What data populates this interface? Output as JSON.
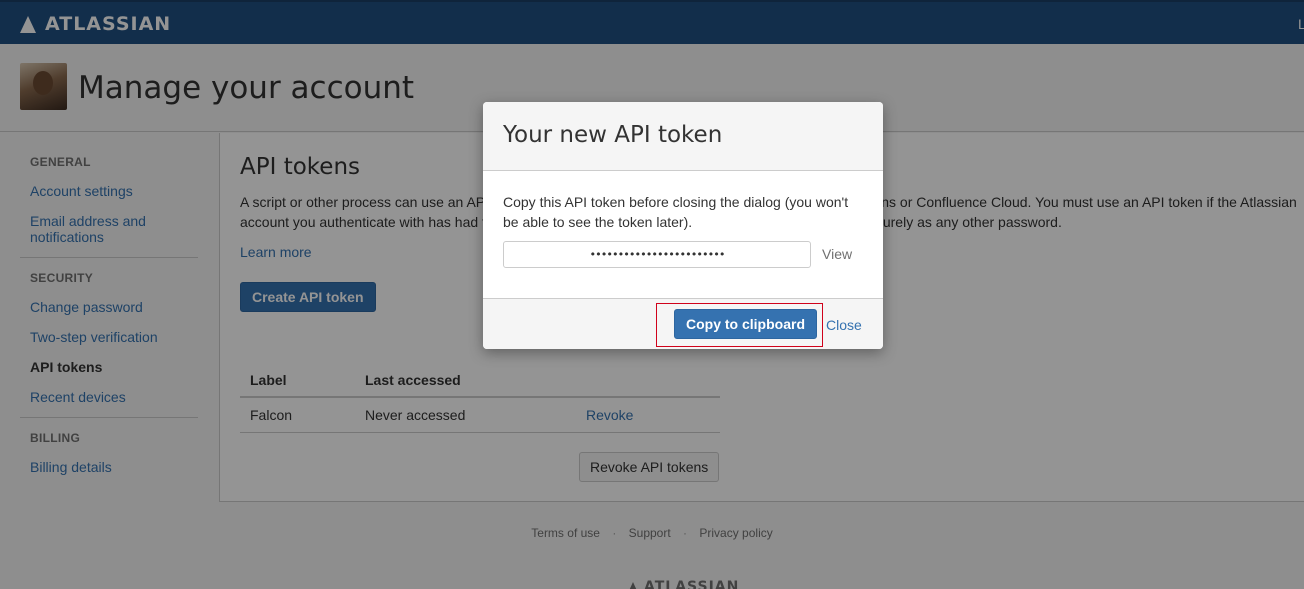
{
  "topbar": {
    "brand": "ATLASSIAN",
    "right_cut": "L"
  },
  "header": {
    "title": "Manage your account"
  },
  "sidebar": {
    "general_heading": "GENERAL",
    "account_settings": "Account settings",
    "email_notifications": "Email address and notifications",
    "security_heading": "SECURITY",
    "change_password": "Change password",
    "two_step": "Two-step verification",
    "api_tokens": "API tokens",
    "recent_devices": "Recent devices",
    "billing_heading": "BILLING",
    "billing_details": "Billing details"
  },
  "main": {
    "title": "API tokens",
    "description": "A script or other process can use an API token to perform basic authentication with Jira Cloud applications or Confluence Cloud. You must use an API token if the Atlassian account you authenticate with has had two-step verification enabled. You should treat API tokens as securely as any other password.",
    "learn_more": "Learn more",
    "create_button": "Create API token",
    "table": {
      "headers": [
        "Label",
        "Last accessed",
        ""
      ],
      "rows": [
        {
          "label": "Falcon",
          "last_accessed": "Never accessed",
          "action": "Revoke"
        }
      ]
    },
    "revoke_all_button": "Revoke API tokens"
  },
  "footer": {
    "terms": "Terms of use",
    "support": "Support",
    "privacy": "Privacy policy",
    "separator": "·",
    "brand": "ATLASSIAN"
  },
  "dialog": {
    "title": "Your new API token",
    "message": "Copy this API token before closing the dialog (you won't be able to see the token later).",
    "token_masked": "••••••••••••••••••••••••",
    "view": "View",
    "copy_button": "Copy to clipboard",
    "close": "Close"
  },
  "colors": {
    "topbar": "#205081",
    "link": "#3572b0",
    "primary_button": "#3572b0",
    "highlight": "#d0021b"
  }
}
